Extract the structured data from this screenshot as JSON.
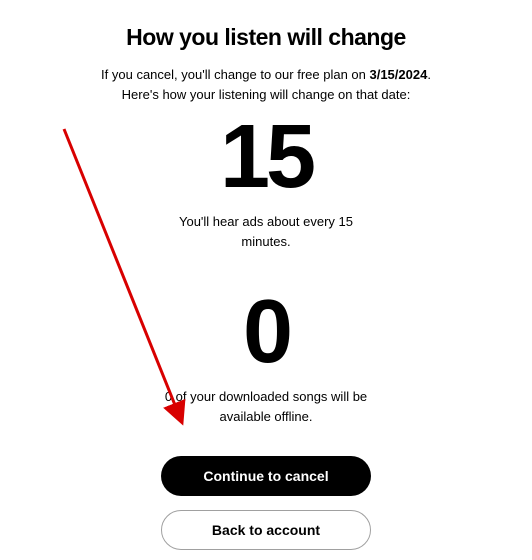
{
  "heading": "How you listen will change",
  "subtitle": {
    "prefix": "If you cancel, you'll change to our free plan on ",
    "date": "3/15/2024",
    "suffix": ".",
    "line2": "Here's how your listening will change on that date:"
  },
  "stats": [
    {
      "value": "15",
      "caption": "You'll hear ads about every 15 minutes."
    },
    {
      "value": "0",
      "caption": "0 of your downloaded songs will be available offline."
    }
  ],
  "buttons": {
    "primary": "Continue to cancel",
    "secondary": "Back to account"
  },
  "annotation": {
    "arrow_color": "#d80000"
  }
}
